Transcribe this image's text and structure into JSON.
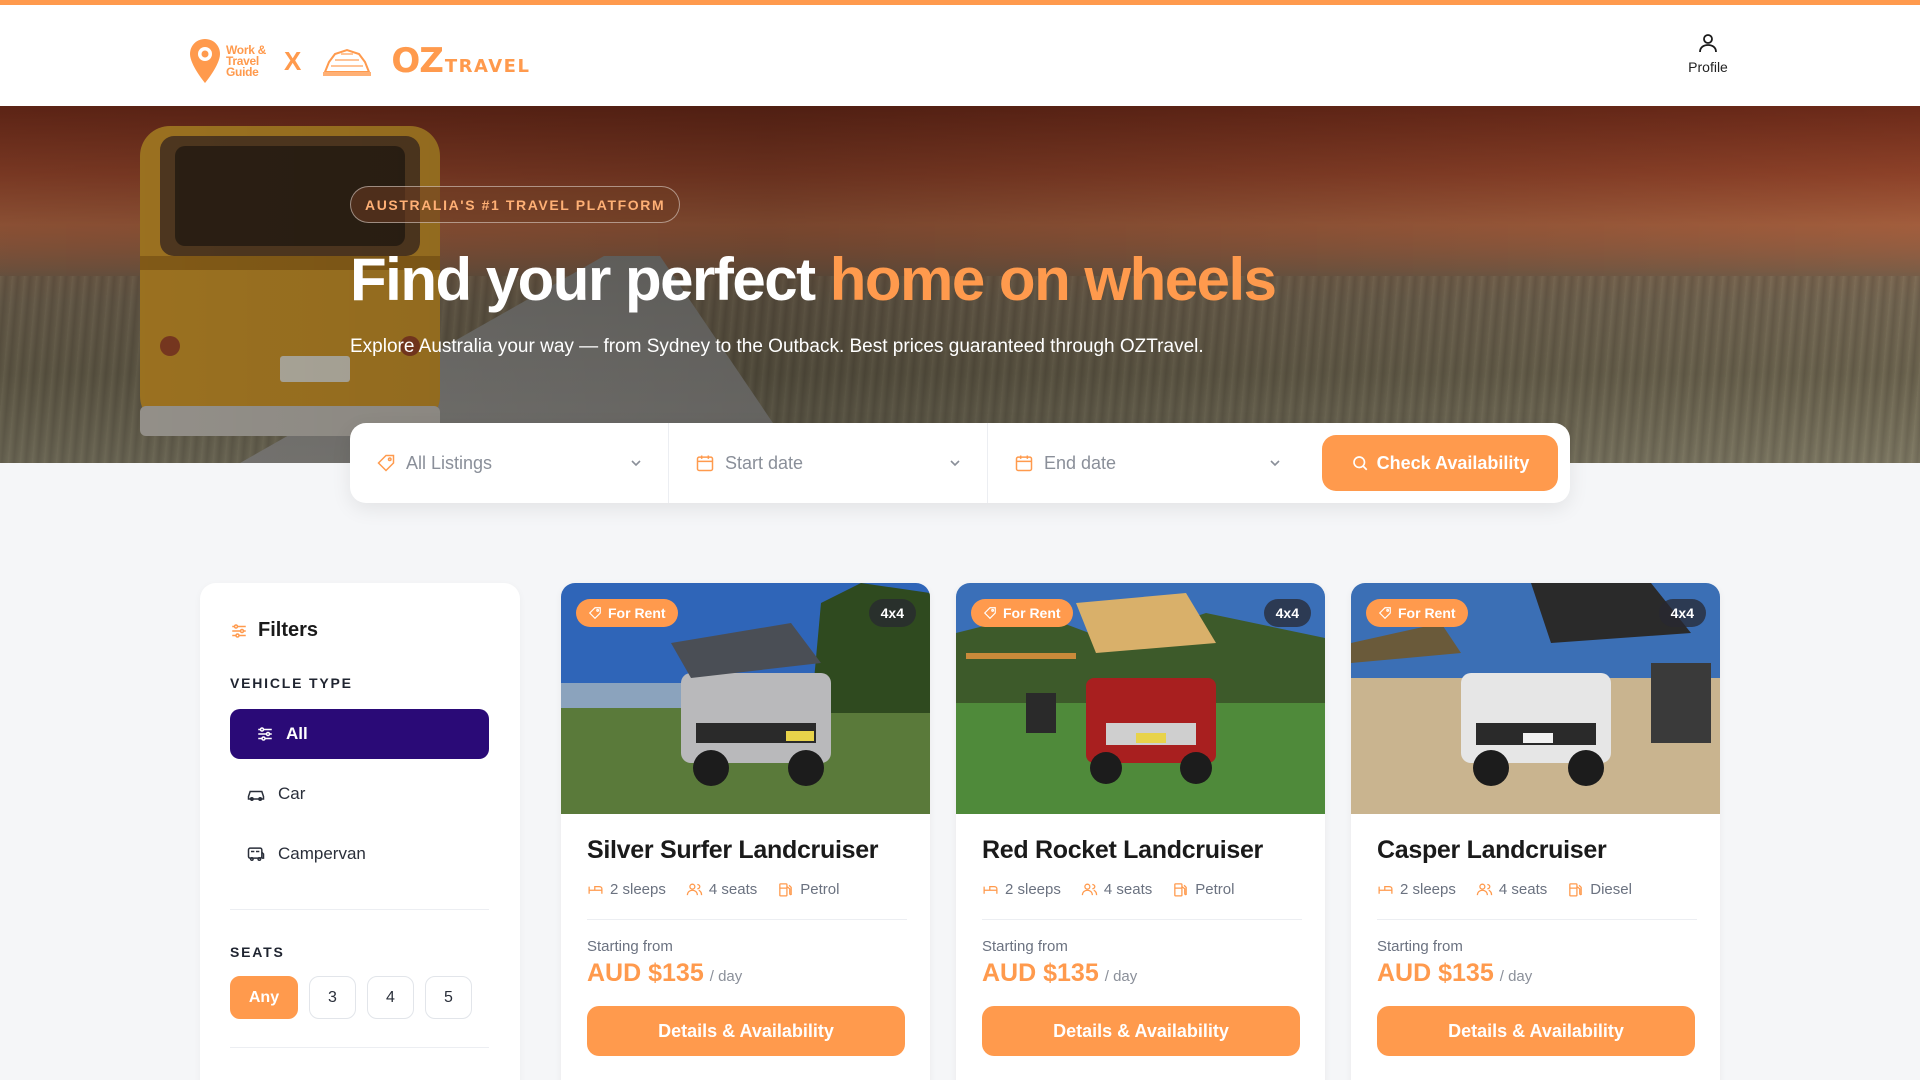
{
  "brand": {
    "partner_lines": [
      "Work &",
      "Travel",
      "Guide"
    ],
    "separator": "X",
    "oz_big": "OZ",
    "oz_small": "TRAVEL",
    "accent_color": "#ff9a4d",
    "primary_color": "#2a0a77"
  },
  "header": {
    "profile_label": "Profile",
    "profile_icon": "user-icon"
  },
  "hero": {
    "badge": "AUSTRALIA'S #1 TRAVEL PLATFORM",
    "title_main": "Find your perfect",
    "title_accent": "home on wheels",
    "subtitle": "Explore Australia your way — from Sydney to the Outback. Best prices guaranteed through OZTravel."
  },
  "search": {
    "listing": "All Listings",
    "start_date": "Start date",
    "end_date": "End date",
    "button": "Check Availability"
  },
  "filters": {
    "title": "Filters",
    "vehicle_type_label": "VEHICLE TYPE",
    "vehicle_types": [
      {
        "label": "All",
        "icon": "sliders-icon",
        "selected": true
      },
      {
        "label": "Car",
        "icon": "car-icon"
      },
      {
        "label": "Campervan",
        "icon": "campervan-icon"
      }
    ],
    "seats_label": "SEATS",
    "seats": [
      "Any",
      "3",
      "4",
      "5"
    ],
    "seats_selected": "Any"
  },
  "listings": [
    {
      "tag": "For Rent",
      "drive": "4x4",
      "name": "Silver Surfer Landcruiser",
      "sleeps": "2 sleeps",
      "seats": "4 seats",
      "fuel": "Petrol",
      "starting_label": "Starting from",
      "price": "AUD $135",
      "per": "/ day",
      "button": "Details & Availability"
    },
    {
      "tag": "For Rent",
      "drive": "4x4",
      "name": "Red Rocket Landcruiser",
      "sleeps": "2 sleeps",
      "seats": "4 seats",
      "fuel": "Petrol",
      "starting_label": "Starting from",
      "price": "AUD $135",
      "per": "/ day",
      "button": "Details & Availability"
    },
    {
      "tag": "For Rent",
      "drive": "4x4",
      "name": "Casper Landcruiser",
      "sleeps": "2 sleeps",
      "seats": "4 seats",
      "fuel": "Diesel",
      "starting_label": "Starting from",
      "price": "AUD $135",
      "per": "/ day",
      "button": "Details & Availability"
    }
  ]
}
